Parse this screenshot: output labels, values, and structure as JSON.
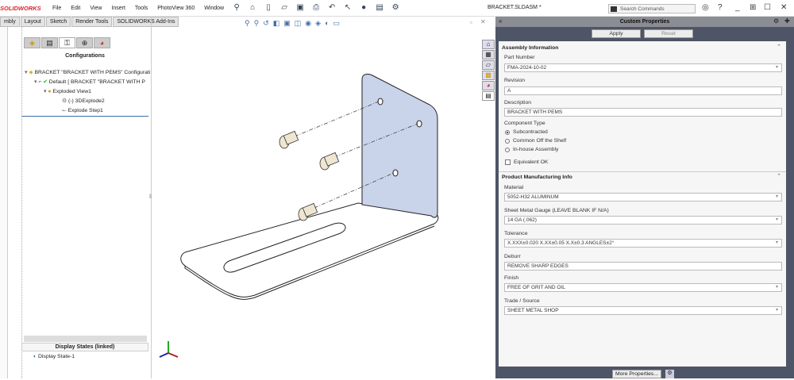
{
  "app": {
    "logo": "SOLIDWORKS",
    "document_title": "BRACKET.SLDASM *",
    "menu": [
      "File",
      "Edit",
      "View",
      "Insert",
      "Tools",
      "PhotoView 360",
      "Window"
    ],
    "search_placeholder": "Search Commands"
  },
  "tabs": [
    "mbly",
    "Layout",
    "Sketch",
    "Render Tools",
    "SOLIDWORKS Add-Ins"
  ],
  "feature_manager": {
    "title": "Configurations",
    "tree": [
      {
        "label": "BRACKET \"BRACKET WITH PEMS\" Configurati",
        "level": 0
      },
      {
        "label": "Default [ BRACKET \"BRACKET WITH P",
        "level": 1
      },
      {
        "label": "Exploded View1",
        "level": 2
      },
      {
        "label": "(-) 3DExplode2",
        "level": 3
      },
      {
        "label": "Explode Step1",
        "level": 3
      }
    ],
    "display_states_title": "Display States (linked)",
    "display_state": "Display State-1"
  },
  "task_pane": {
    "title": "Custom Properties",
    "apply": "Apply",
    "reset": "Reset",
    "more_properties": "More Properties...",
    "assembly_info": {
      "title": "Assembly Information",
      "part_number_label": "Part Number",
      "part_number": "FMA-2024-10-02",
      "revision_label": "Revision",
      "revision": "A",
      "description_label": "Description",
      "description": "BRACKET WITH PEMS",
      "component_type_label": "Component Type",
      "component_types": [
        "Subcontracted",
        "Common Off the Shelf",
        "In-house Assembly"
      ],
      "component_type_selected": "Subcontracted",
      "equivalent_ok_label": "Equivalent OK",
      "equivalent_ok": false
    },
    "pmi": {
      "title": "Product Manufacturing Info",
      "material_label": "Material",
      "material": "5052-H32 ALUMINUM",
      "gauge_label": "Sheet Metal Gauge (LEAVE BLANK IF N/A)",
      "gauge": "14 GA (.062)",
      "tolerance_label": "Tolerance",
      "tolerance": "X.XXX±0.020 X.XX±0.05 X.X±0.3 ANGLES±2°",
      "deburr_label": "Deburr",
      "deburr": "REMOVE SHARP EDGES",
      "finish_label": "Finish",
      "finish": "FREE OF GRIT AND OIL",
      "trade_label": "Trade / Source",
      "trade": "SHEET METAL SHOP"
    }
  }
}
